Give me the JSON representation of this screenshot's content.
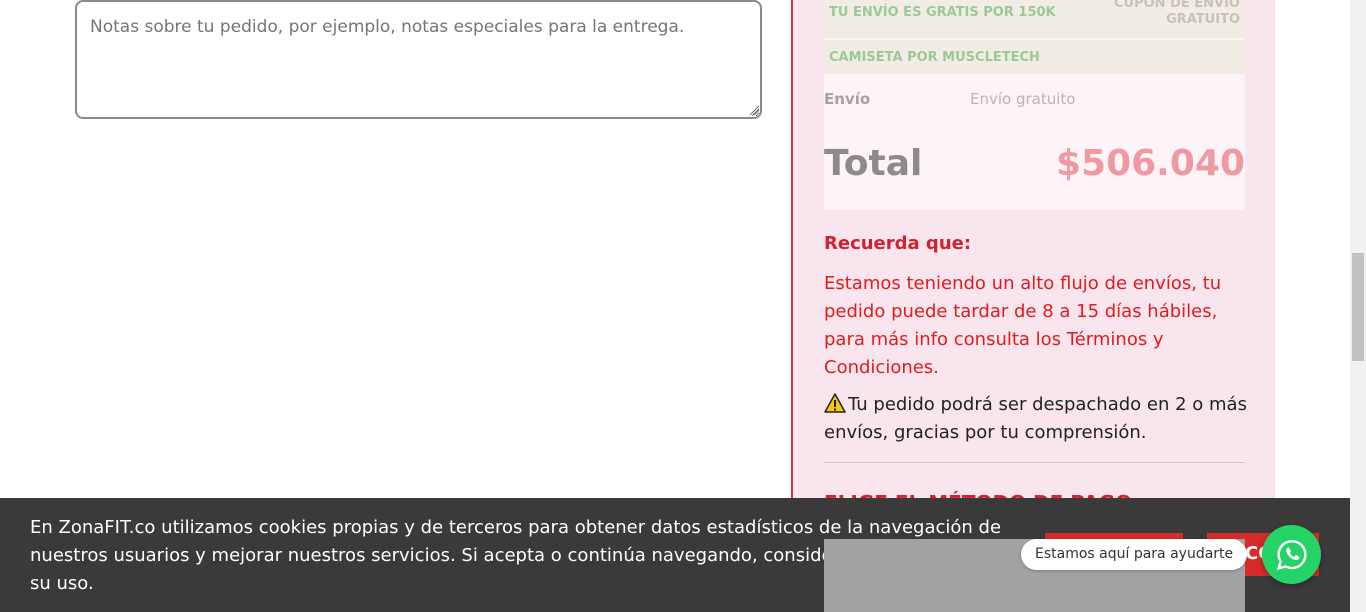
{
  "notes": {
    "placeholder": "Notas sobre tu pedido, por ejemplo, notas especiales para la entrega."
  },
  "order_summary": {
    "coupon_left": "TU ENVÍO ES GRATIS POR 150K",
    "coupon_right": "CUPÓN DE ENVÍO GRATUITO",
    "shirt_label": "CAMISETA POR MUSCLETECH",
    "shipping_label": "Envío",
    "shipping_value": "Envío gratuito",
    "total_label": "Total",
    "total_value": "$506.040"
  },
  "notice": {
    "title": "Recuerda que:",
    "body": "Estamos teniendo un alto flujo de envíos, tu pedido puede tardar de 8 a 15 días hábiles, para más info consulta los Términos y Condiciones.",
    "warning": "Tu pedido podrá ser despachado en 2 o más envíos, gracias por tu comprensión."
  },
  "payment": {
    "title": "ELIGE EL MÉTODO DE PAGO"
  },
  "cookie_banner": {
    "text": "En ZonaFIT.co utilizamos cookies propias y de terceros para obtener datos estadísticos de la navegación de nuestros usuarios y mejorar nuestros servicios. Si acepta o continúa navegando, consideramos que acepta su uso.",
    "button_right_label": "CO"
  },
  "whatsapp": {
    "bubble_text": "Estamos aquí para ayudarte",
    "icon": "whatsapp-icon"
  },
  "colors": {
    "accent_red": "#d72a2a",
    "whatsapp_green": "#25d366",
    "cookie_bg": "#3a3a3a"
  }
}
